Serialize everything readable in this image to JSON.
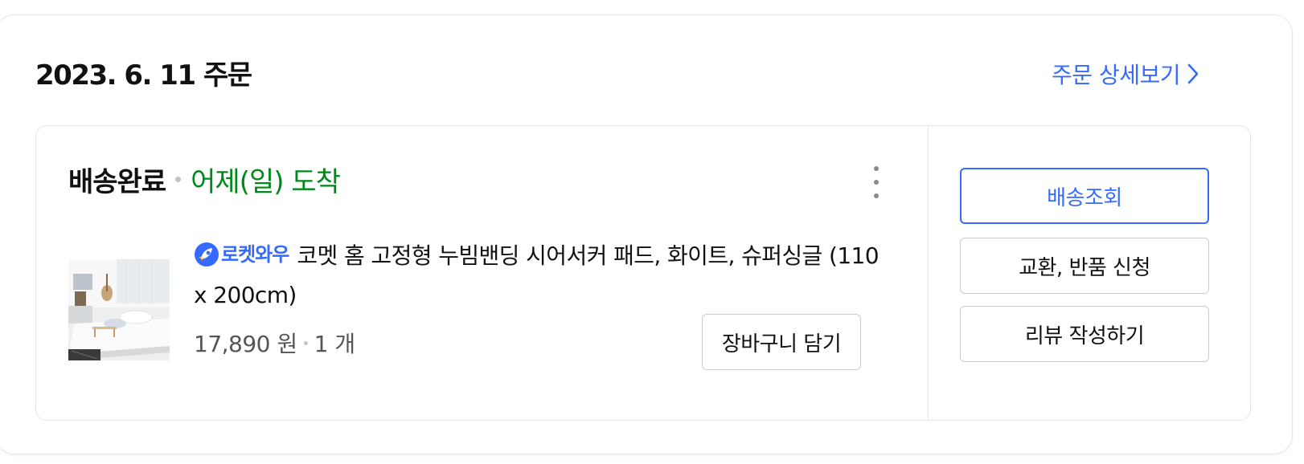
{
  "order": {
    "date_title": "2023. 6. 11 주문",
    "detail_link_label": "주문 상세보기"
  },
  "shipment": {
    "status": "배송완료",
    "arrival": "어제(일) 도착"
  },
  "product": {
    "badge_label": "로켓와우",
    "name": "코멧 홈 고정형 누빔밴딩 시어서커 패드, 화이트, 슈퍼싱글 (110 x 200cm)",
    "price": "17,890 원",
    "quantity": "1 개",
    "cart_button_label": "장바구니 담기"
  },
  "actions": {
    "track_label": "배송조회",
    "exchange_return_label": "교환, 반품 신청",
    "review_label": "리뷰 작성하기"
  },
  "colors": {
    "accent": "#346aff",
    "arrival_green": "#00891a"
  },
  "icons": {
    "detail_link": "chevron-right-icon",
    "more": "more-vertical-icon",
    "badge": "rocket-icon"
  }
}
